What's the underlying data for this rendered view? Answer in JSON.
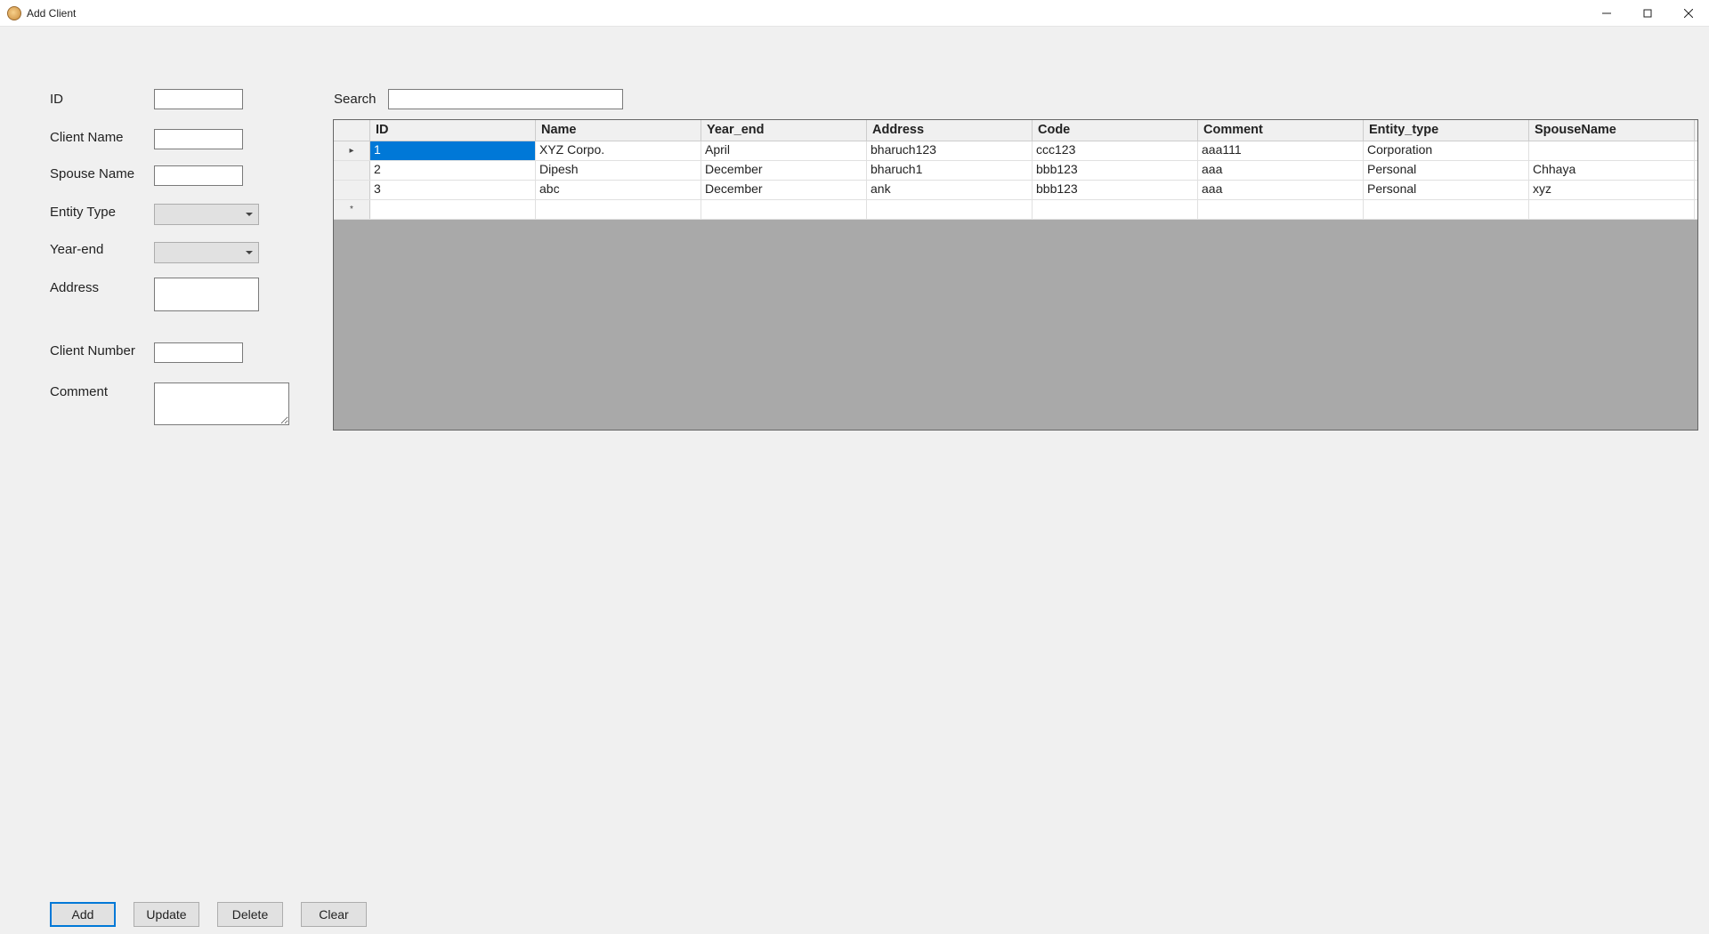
{
  "window": {
    "title": "Add Client"
  },
  "form": {
    "labels": {
      "id": "ID",
      "client_name": "Client Name",
      "spouse_name": "Spouse Name",
      "entity_type": "Entity Type",
      "year_end": "Year-end",
      "address": "Address",
      "client_number": "Client Number",
      "comment": "Comment",
      "search": "Search"
    },
    "values": {
      "id": "",
      "client_name": "",
      "spouse_name": "",
      "entity_type": "",
      "year_end": "",
      "address": "",
      "client_number": "",
      "comment": "",
      "search": ""
    }
  },
  "grid": {
    "columns": [
      "ID",
      "Name",
      "Year_end",
      "Address",
      "Code",
      "Comment",
      "Entity_type",
      "SpouseName"
    ],
    "rows": [
      {
        "id": "1",
        "name": "XYZ Corpo.",
        "year_end": "April",
        "address": "bharuch123",
        "code": "ccc123",
        "comment": "aaa111",
        "entity_type": "Corporation",
        "spouse_name": ""
      },
      {
        "id": "2",
        "name": "Dipesh",
        "year_end": "December",
        "address": "bharuch1",
        "code": "bbb123",
        "comment": "aaa",
        "entity_type": "Personal",
        "spouse_name": "Chhaya"
      },
      {
        "id": "3",
        "name": "abc",
        "year_end": "December",
        "address": "ank",
        "code": "bbb123",
        "comment": "aaa",
        "entity_type": "Personal",
        "spouse_name": "xyz"
      }
    ],
    "selected_cell": {
      "row": 0,
      "col": "id"
    },
    "row_indicator_current": "▸",
    "row_indicator_new": "*"
  },
  "buttons": {
    "add": "Add",
    "update": "Update",
    "delete": "Delete",
    "clear": "Clear"
  }
}
